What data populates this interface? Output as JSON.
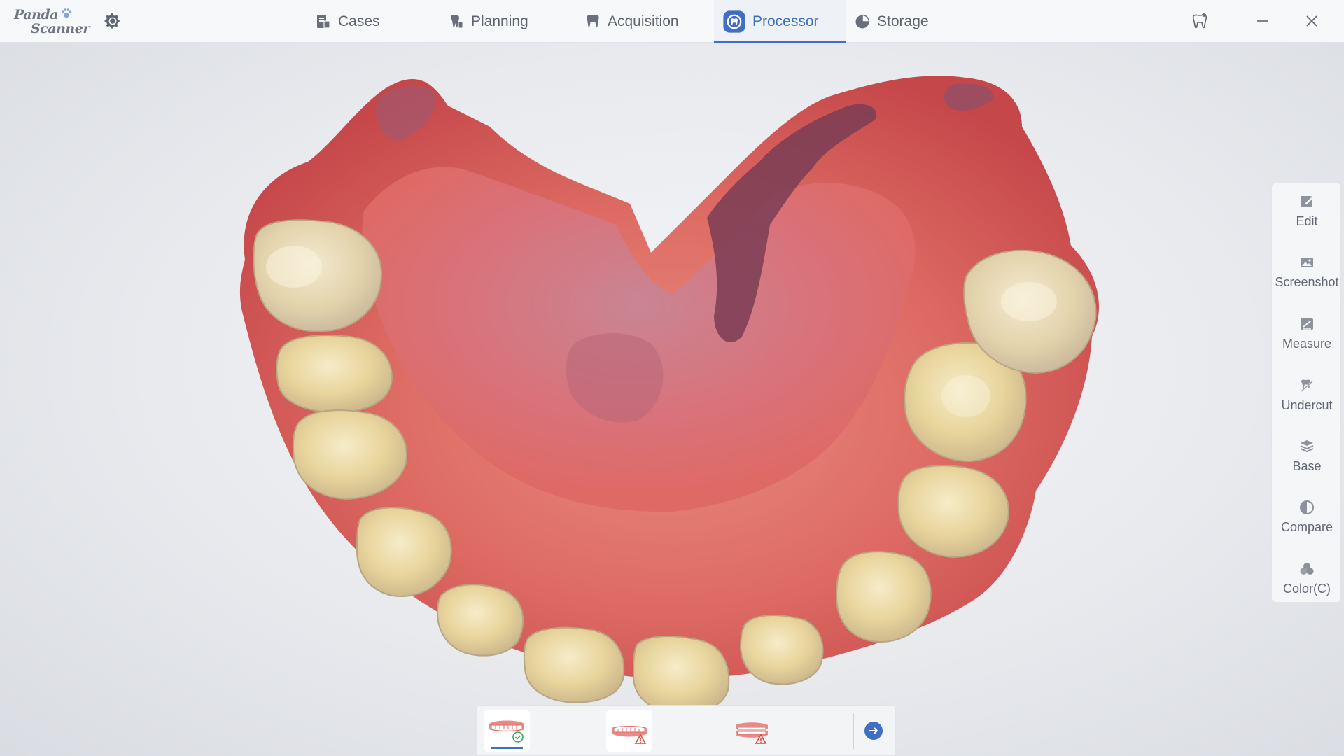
{
  "app": {
    "logo_line1": "Panda",
    "logo_line2": "Scanner",
    "settings_icon": "gear-icon"
  },
  "nav": {
    "tabs": [
      {
        "label": "Cases",
        "icon": "cases-icon",
        "active": false
      },
      {
        "label": "Planning",
        "icon": "planning-icon",
        "active": false
      },
      {
        "label": "Acquisition",
        "icon": "acquisition-icon",
        "active": false
      },
      {
        "label": "Processor",
        "icon": "processor-icon",
        "active": true
      },
      {
        "label": "Storage",
        "icon": "storage-icon",
        "active": false
      }
    ]
  },
  "window_controls": [
    "tooth-icon",
    "minimize-icon",
    "close-icon"
  ],
  "tools": [
    {
      "label": "Edit",
      "icon": "edit-icon"
    },
    {
      "label": "Screenshot",
      "icon": "screenshot-icon"
    },
    {
      "label": "Measure",
      "icon": "measure-icon"
    },
    {
      "label": "Undercut",
      "icon": "undercut-icon"
    },
    {
      "label": "Base",
      "icon": "base-icon"
    },
    {
      "label": "Compare",
      "icon": "compare-icon"
    },
    {
      "label": "Color(C)",
      "icon": "color-icon"
    }
  ],
  "jaws": [
    {
      "name": "upper-jaw",
      "status": "ok",
      "selected": true
    },
    {
      "name": "lower-jaw",
      "status": "warning",
      "selected": false
    },
    {
      "name": "bite",
      "status": "warning",
      "selected": false
    }
  ],
  "colors": {
    "accent": "#3f6fc4",
    "topbar_bg": "#f7f8fa",
    "text": "#5e6470",
    "gum": "#d8625c",
    "tooth": "#e6d49b",
    "ok": "#3aa35a",
    "warning": "#e0453c"
  }
}
